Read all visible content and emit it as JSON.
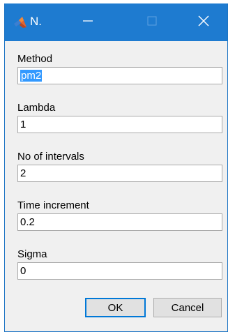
{
  "window": {
    "title": "N.",
    "icon": "matlab-icon",
    "titlebar_color": "#1e7bd0",
    "controls": {
      "minimize_icon": "minimize-icon",
      "maximize_icon": "maximize-icon",
      "close_icon": "close-icon"
    }
  },
  "fields": [
    {
      "label": "Method",
      "value": "pm2",
      "selected": true
    },
    {
      "label": "Lambda",
      "value": "1"
    },
    {
      "label": "No of intervals",
      "value": "2"
    },
    {
      "label": "Time increment",
      "value": "0.2"
    },
    {
      "label": "Sigma",
      "value": "0"
    }
  ],
  "buttons": {
    "ok": "OK",
    "cancel": "Cancel"
  }
}
